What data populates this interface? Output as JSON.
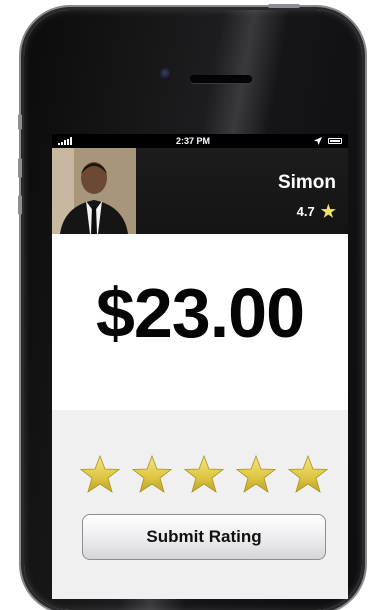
{
  "status_bar": {
    "time": "2:37 PM",
    "signal_icon": "signal-bars-icon",
    "location_icon": "location-arrow-icon",
    "battery_icon": "battery-icon"
  },
  "driver": {
    "name": "Simon",
    "rating": "4.7",
    "rating_icon": "star-icon",
    "avatar_icon": "driver-photo"
  },
  "fare": {
    "amount": "$23.00"
  },
  "rating": {
    "stars": [
      {
        "icon": "star-icon",
        "selected": true
      },
      {
        "icon": "star-icon",
        "selected": true
      },
      {
        "icon": "star-icon",
        "selected": true
      },
      {
        "icon": "star-icon",
        "selected": true
      },
      {
        "icon": "star-icon",
        "selected": true
      }
    ],
    "submit_label": "Submit Rating"
  },
  "colors": {
    "star": "#E2CC45",
    "header_bg": "#141414",
    "rating_bg": "#F0F0F1"
  }
}
